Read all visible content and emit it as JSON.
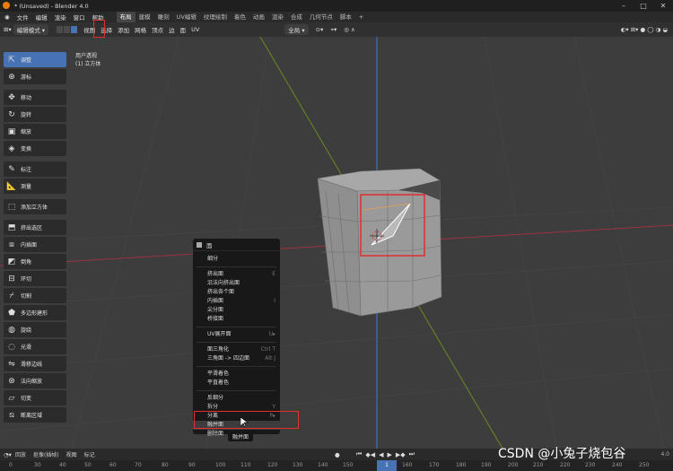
{
  "window": {
    "title": "* (Unsaved) - Blender 4.0"
  },
  "menu": [
    "文件",
    "编辑",
    "渲染",
    "窗口",
    "帮助"
  ],
  "workspace_tabs": [
    "布局",
    "建模",
    "雕刻",
    "UV编辑",
    "纹理绘制",
    "着色",
    "动画",
    "渲染",
    "合成",
    "几何节点",
    "脚本",
    "+"
  ],
  "header": {
    "mode": "编辑模式",
    "menus": [
      "视图",
      "选择",
      "添加",
      "网格",
      "顶点",
      "边",
      "面",
      "UV"
    ],
    "transform_orientation": "全局"
  },
  "viewport": {
    "view_name": "用户透视",
    "object_name": "(1) 立方体"
  },
  "tools": [
    "调整",
    "游标",
    "移动",
    "旋转",
    "缩放",
    "变换",
    "标注",
    "测量",
    "添加立方体",
    "挤出选区",
    "内插面",
    "倒角",
    "环切",
    "切割",
    "多边形建形",
    "旋绕",
    "光滑",
    "滑移边线",
    "法向缩放",
    "切变",
    "断离区域"
  ],
  "context_menu": {
    "title": "面",
    "items": [
      {
        "label": "细分",
        "shortcut": ""
      },
      {
        "label": "挤出面",
        "shortcut": "E"
      },
      {
        "label": "沿法向挤出面",
        "shortcut": ""
      },
      {
        "label": "挤出各个面",
        "shortcut": ""
      },
      {
        "label": "内插面",
        "shortcut": "I"
      },
      {
        "label": "尖分面",
        "shortcut": ""
      },
      {
        "label": "桥接面",
        "shortcut": ""
      },
      {
        "label": "UV展开面",
        "shortcut": "U▸"
      },
      {
        "label": "面三角化",
        "shortcut": "Ctrl T"
      },
      {
        "label": "三角面 -> 四边面",
        "shortcut": "Alt J"
      },
      {
        "label": "平滑着色",
        "shortcut": ""
      },
      {
        "label": "平直着色",
        "shortcut": ""
      },
      {
        "label": "反细分",
        "shortcut": ""
      },
      {
        "label": "拆分",
        "shortcut": "Y"
      },
      {
        "label": "分离",
        "shortcut": "P▸"
      },
      {
        "label": "融并面",
        "shortcut": ""
      },
      {
        "label": "删除面",
        "shortcut": ""
      }
    ],
    "tooltip": "融并面"
  },
  "timeline": {
    "menus": [
      "回放",
      "抠像(插帧)",
      "视图",
      "标记"
    ],
    "current_frame": "1"
  },
  "ruler_ticks": [
    "0",
    "10",
    "20",
    "30",
    "40",
    "50",
    "60",
    "70",
    "80",
    "90",
    "100",
    "110",
    "120",
    "130",
    "140",
    "150",
    "160",
    "170",
    "180",
    "190",
    "200",
    "210",
    "220",
    "230",
    "240",
    "250"
  ],
  "status": {
    "version": "4.0"
  },
  "watermark": "CSDN @小兔子烧包谷",
  "colors": {
    "accent": "#4772b3",
    "highlight_box": "#e03030",
    "x_axis": "#b63b4a",
    "y_axis": "#7c9c2a",
    "z_axis": "#3d7ad1"
  }
}
